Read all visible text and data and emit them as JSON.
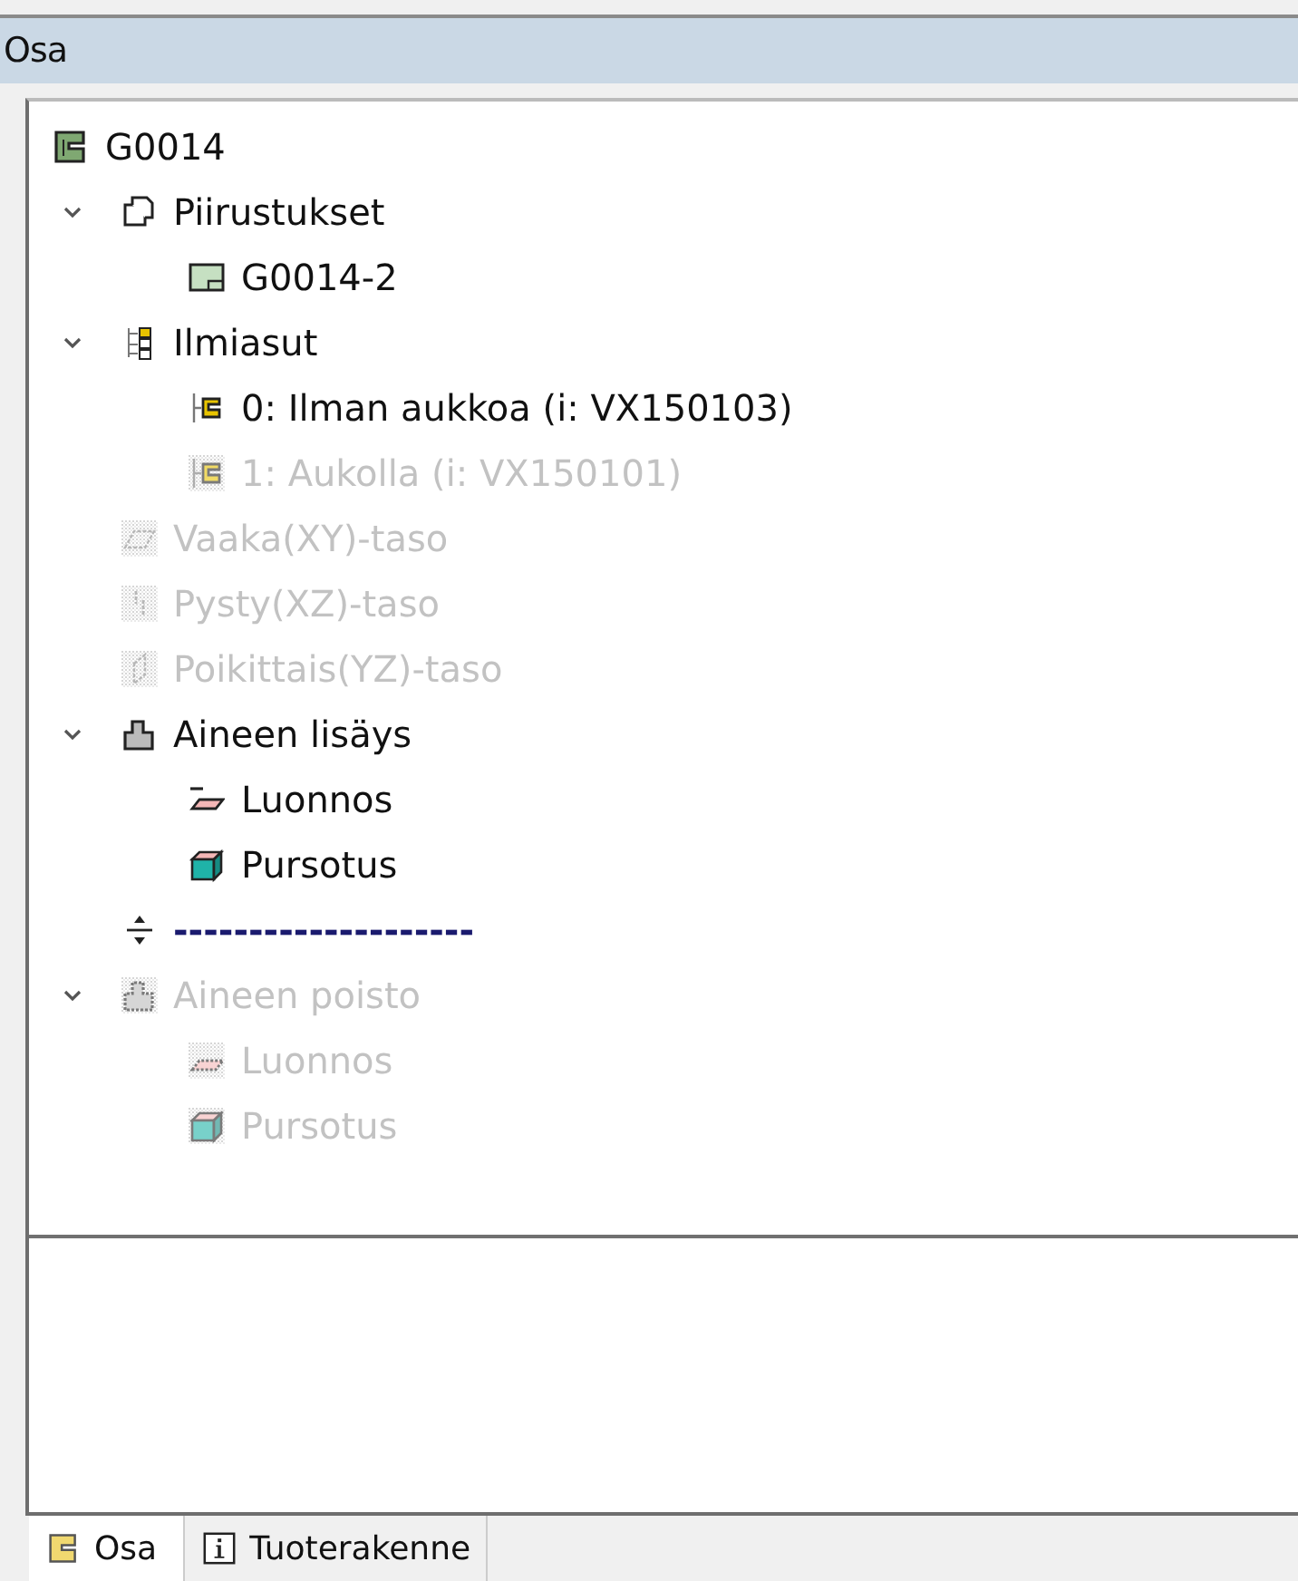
{
  "panel": {
    "title": "Osa"
  },
  "tree": [
    {
      "kind": "part",
      "label": "G0014",
      "disabled": false,
      "children": [
        {
          "kind": "drawings",
          "label": "Piirustukset",
          "disabled": false,
          "expanded": true,
          "children": [
            {
              "kind": "drawing",
              "label": "G0014-2",
              "disabled": false
            }
          ]
        },
        {
          "kind": "views",
          "label": "Ilmiasut",
          "disabled": false,
          "expanded": true,
          "children": [
            {
              "kind": "view",
              "label": "0: Ilman aukkoa (i: VX150103)",
              "disabled": false
            },
            {
              "kind": "view",
              "label": "1: Aukolla (i: VX150101)",
              "disabled": true
            }
          ]
        },
        {
          "kind": "plane-xy",
          "label": "Vaaka(XY)-taso",
          "disabled": true
        },
        {
          "kind": "plane-xz",
          "label": "Pysty(XZ)-taso",
          "disabled": true
        },
        {
          "kind": "plane-yz",
          "label": "Poikittais(YZ)-taso",
          "disabled": true
        },
        {
          "kind": "add-feature",
          "label": "Aineen lisäys",
          "disabled": false,
          "expanded": true,
          "children": [
            {
              "kind": "sketch",
              "label": "Luonnos",
              "disabled": false
            },
            {
              "kind": "extrude",
              "label": "Pursotus",
              "disabled": false
            }
          ]
        },
        {
          "kind": "separator",
          "label": "--------------------",
          "disabled": false
        },
        {
          "kind": "remove-feature",
          "label": "Aineen poisto",
          "disabled": true,
          "expanded": true,
          "children": [
            {
              "kind": "sketch",
              "label": "Luonnos",
              "disabled": true
            },
            {
              "kind": "extrude",
              "label": "Pursotus",
              "disabled": true
            }
          ]
        }
      ]
    }
  ],
  "tabs": [
    {
      "kind": "part",
      "label": "Osa",
      "selected": true
    },
    {
      "kind": "info",
      "label": "Tuoterakenne",
      "selected": false
    }
  ]
}
